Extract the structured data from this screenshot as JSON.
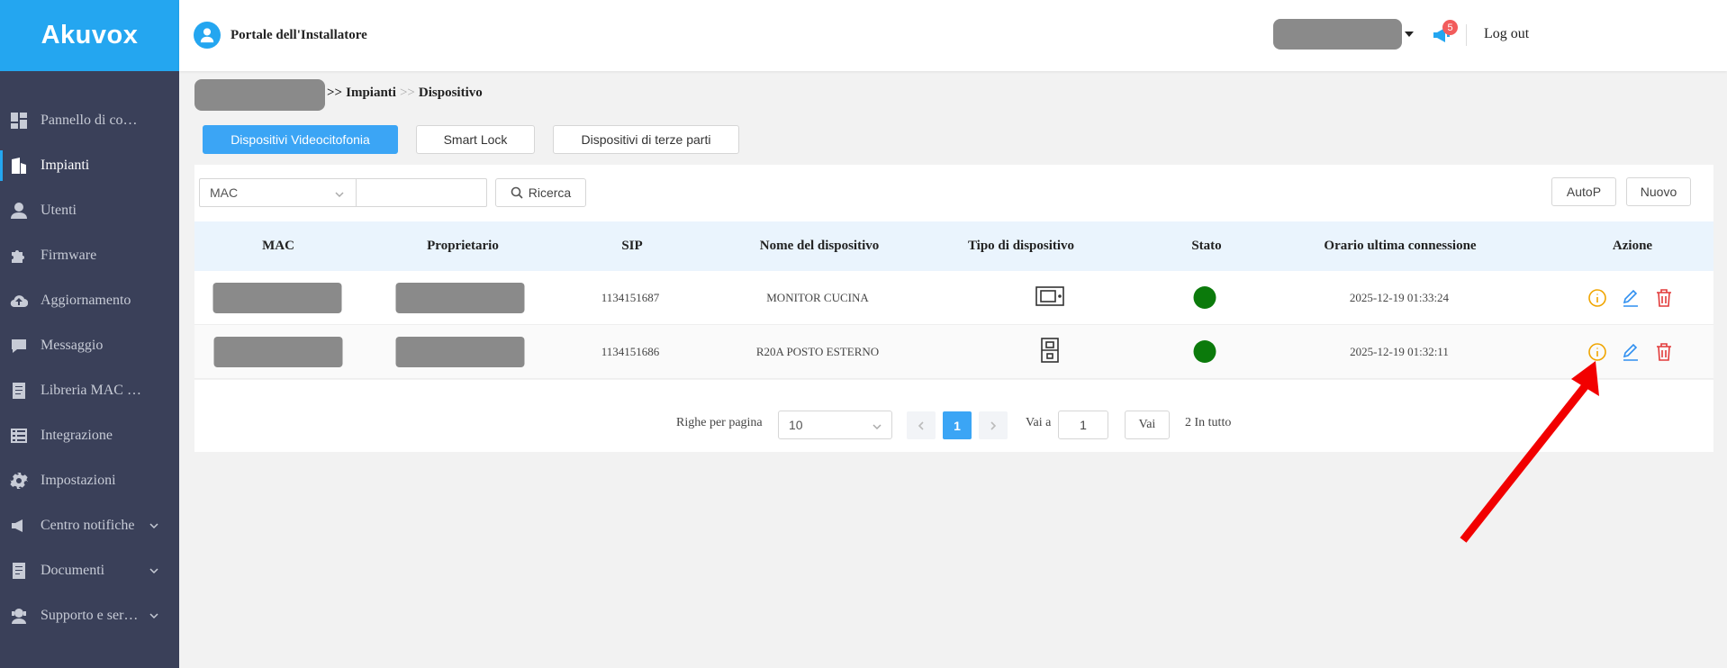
{
  "app": {
    "logo": "Akuvox",
    "portal_title": "Portale dell'Installatore",
    "logout": "Log out",
    "notification_count": "5"
  },
  "sidebar": {
    "items": [
      {
        "label": "Pannello di co…",
        "icon": "dashboard-icon",
        "active": false,
        "chevron": false
      },
      {
        "label": "Impianti",
        "icon": "building-icon",
        "active": true,
        "chevron": false
      },
      {
        "label": "Utenti",
        "icon": "user-icon",
        "active": false,
        "chevron": false
      },
      {
        "label": "Firmware",
        "icon": "puzzle-icon",
        "active": false,
        "chevron": false
      },
      {
        "label": "Aggiornamento",
        "icon": "cloud-upload-icon",
        "active": false,
        "chevron": false
      },
      {
        "label": "Messaggio",
        "icon": "chat-icon",
        "active": false,
        "chevron": false
      },
      {
        "label": "Libreria MAC …",
        "icon": "document-icon",
        "active": false,
        "chevron": false
      },
      {
        "label": "Integrazione",
        "icon": "list-icon",
        "active": false,
        "chevron": false
      },
      {
        "label": "Impostazioni",
        "icon": "gear-icon",
        "active": false,
        "chevron": false
      },
      {
        "label": "Centro notifiche",
        "icon": "megaphone-icon",
        "active": false,
        "chevron": true
      },
      {
        "label": "Documenti",
        "icon": "file-icon",
        "active": false,
        "chevron": true
      },
      {
        "label": "Supporto e ser…",
        "icon": "support-icon",
        "active": false,
        "chevron": true
      }
    ]
  },
  "breadcrumb": {
    "sep1": ">>",
    "impianti": "Impianti",
    "sep2": ">>",
    "dispositivo": "Dispositivo"
  },
  "tabs": [
    {
      "label": "Dispositivi Videocitofonia",
      "active": true
    },
    {
      "label": "Smart Lock",
      "active": false
    },
    {
      "label": "Dispositivi di terze parti",
      "active": false
    }
  ],
  "toolbar": {
    "filter_value": "MAC",
    "search_value": "",
    "search_label": "Ricerca",
    "autop_label": "AutoP",
    "new_label": "Nuovo"
  },
  "table": {
    "headers": {
      "mac": "MAC",
      "owner": "Proprietario",
      "sip": "SIP",
      "name": "Nome del dispositivo",
      "type": "Tipo di dispositivo",
      "status": "Stato",
      "last": "Orario ultima connessione",
      "action": "Azione"
    },
    "rows": [
      {
        "sip": "1134151687",
        "name": "MONITOR CUCINA",
        "type_icon": "monitor-icon",
        "status_color": "#0b7a0b",
        "last": "2025-12-19 01:33:24"
      },
      {
        "sip": "1134151686",
        "name": "R20A POSTO ESTERNO",
        "type_icon": "door-station-icon",
        "status_color": "#0b7a0b",
        "last": "2025-12-19 01:32:11"
      }
    ]
  },
  "pagination": {
    "rows_label": "Righe per pagina",
    "page_size": "10",
    "current": "1",
    "goto_label": "Vai a",
    "goto_value": "1",
    "go_label": "Vai",
    "total": "2 In tutto"
  },
  "colors": {
    "brand": "#24a6f0",
    "sidebar": "#3a4059",
    "status_ok": "#0b7a0b",
    "info": "#f0a500",
    "edit": "#2f8ff0",
    "delete": "#e23a3a",
    "annotation": "#f20000"
  }
}
